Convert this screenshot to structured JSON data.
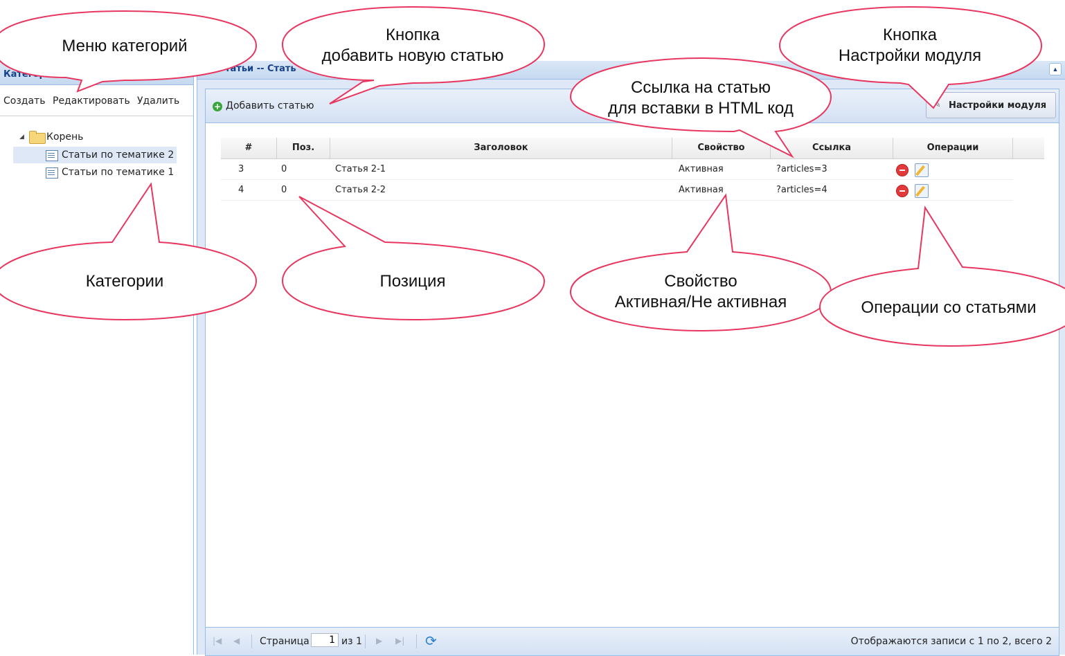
{
  "left_panel": {
    "title": "Категор",
    "toolbar": {
      "create": "Создать",
      "edit": "Редактировать",
      "delete": "Удалить"
    },
    "tree": {
      "root": "Корень",
      "items": [
        "Статьи по тематике 2",
        "Статьи по тематике 1"
      ],
      "selected_index": 0
    }
  },
  "right_panel": {
    "title": "татьи -- Стать",
    "toolbar": {
      "add_label": "Добавить статью",
      "settings_label": "Настройки модуля"
    },
    "grid": {
      "columns": [
        "#",
        "Поз.",
        "Заголовок",
        "Свойство",
        "Ссылка",
        "Операции"
      ],
      "rows": [
        {
          "id": "3",
          "pos": "0",
          "title": "Статья 2-1",
          "status": "Активная",
          "link": "?articles=3"
        },
        {
          "id": "4",
          "pos": "0",
          "title": "Статья 2-2",
          "status": "Активная",
          "link": "?articles=4"
        }
      ]
    },
    "pager": {
      "page_label": "Страница",
      "page_value": "1",
      "of_label": "из 1",
      "status": "Отображаются записи с 1 по 2, всего 2"
    }
  },
  "annotations": {
    "menu": "Меню категорий",
    "add_button": [
      "Кнопка",
      "добавить новую статью"
    ],
    "settings_button": [
      "Кнопка",
      "Настройки модуля"
    ],
    "link": [
      "Ссылка на статью",
      "для вставки в HTML код"
    ],
    "categories": "Категории",
    "position": "Позиция",
    "property": [
      "Свойство",
      "Активная/Не активная"
    ],
    "operations": "Операции со статьями"
  },
  "colors": {
    "callout_stroke": "#e8365f",
    "header_blue": "#15428b",
    "panel_border": "#99bbe8"
  }
}
